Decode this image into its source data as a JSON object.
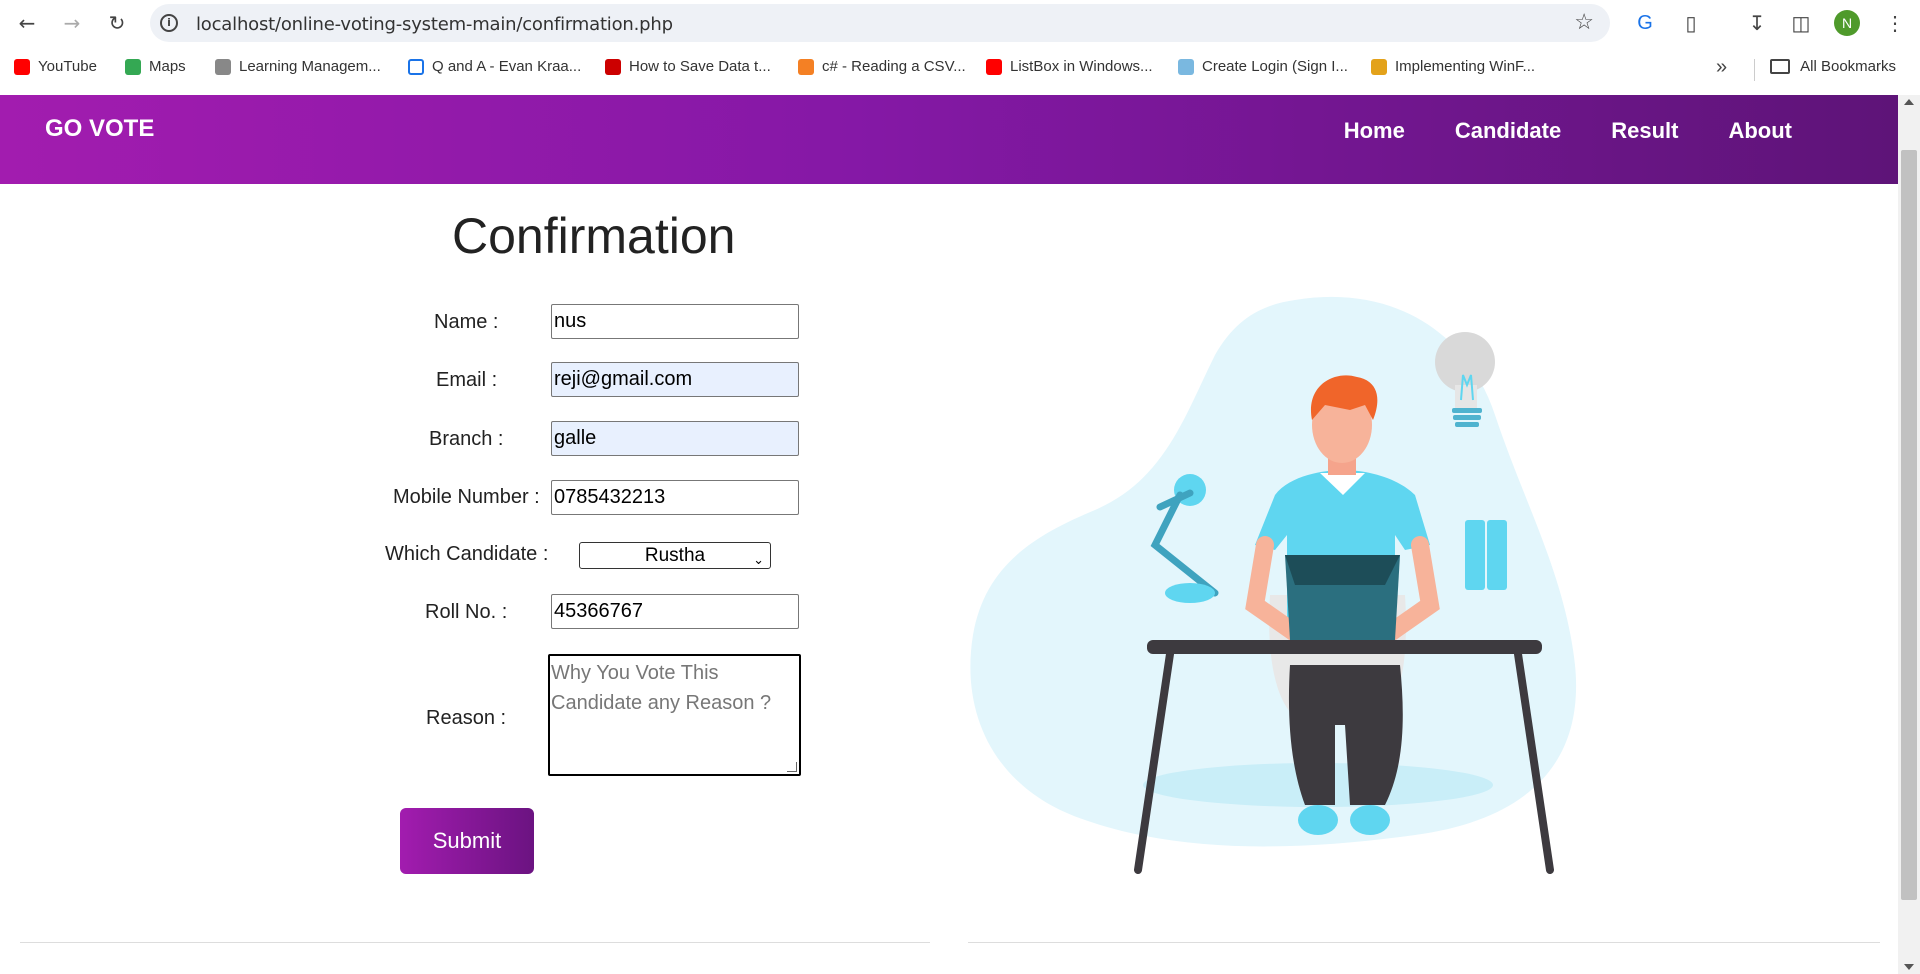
{
  "browser": {
    "url": "localhost/online-voting-system-main/confirmation.php",
    "avatar_letter": "N",
    "bookmarks": [
      {
        "label": "YouTube",
        "color": "#ff0000"
      },
      {
        "label": "Maps",
        "color": "#34a853"
      },
      {
        "label": "Learning Managem...",
        "color": "#888888"
      },
      {
        "label": "Q and A - Evan Kraa...",
        "color": "#1a73e8"
      },
      {
        "label": "How to Save Data t...",
        "color": "#cc0000"
      },
      {
        "label": "c# - Reading a CSV...",
        "color": "#f48024"
      },
      {
        "label": "ListBox in Windows...",
        "color": "#ff0000"
      },
      {
        "label": "Create Login (Sign I...",
        "color": "#7ab8e0"
      },
      {
        "label": "Implementing WinF...",
        "color": "#e3a21a"
      }
    ],
    "all_bookmarks": "All Bookmarks"
  },
  "site": {
    "brand": "GO VOTE",
    "nav": [
      "Home",
      "Candidate",
      "Result",
      "About"
    ]
  },
  "form": {
    "title": "Confirmation",
    "name_label": "Name :",
    "name_value": "nus",
    "email_label": "Email :",
    "email_value": "reji@gmail.com",
    "branch_label": "Branch :",
    "branch_value": "galle",
    "mobile_label": "Mobile Number :",
    "mobile_value": "0785432213",
    "candidate_label": "Which Candidate :",
    "candidate_value": "Rustha",
    "roll_label": "Roll No. :",
    "roll_value": "45366767",
    "reason_label": "Reason :",
    "reason_placeholder": "Why You Vote This Candidate any Reason ?",
    "submit_label": "Submit"
  },
  "colors": {
    "header_start": "#a21caf",
    "header_end": "#5e1478",
    "illustration_bg": "#e3f6fc",
    "shirt": "#5fd6f0",
    "hair": "#f0652a"
  }
}
